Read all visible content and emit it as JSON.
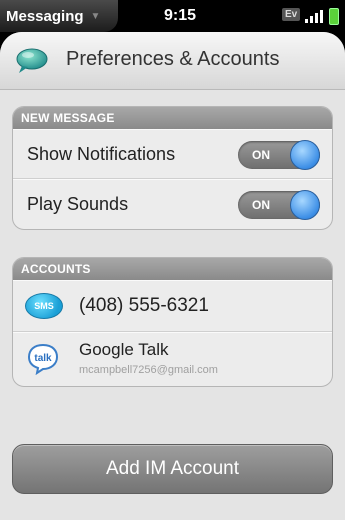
{
  "status_bar": {
    "app_name": "Messaging",
    "time": "9:15",
    "network": "Ev"
  },
  "header": {
    "title": "Preferences & Accounts",
    "icon": "messaging-bubble-icon"
  },
  "new_message": {
    "section_title": "NEW MESSAGE",
    "rows": [
      {
        "label": "Show Notifications",
        "toggle": "ON"
      },
      {
        "label": "Play Sounds",
        "toggle": "ON"
      }
    ]
  },
  "accounts": {
    "section_title": "ACCOUNTS",
    "items": [
      {
        "icon_text": "SMS",
        "name": "(408) 555-6321"
      },
      {
        "icon_text": "talk",
        "name": "Google Talk",
        "email": "mcampbell7256@gmail.com"
      }
    ]
  },
  "add_account_label": "Add IM Account",
  "colors": {
    "toggle_knob": "#3c8ee6",
    "battery": "#5bd23a",
    "section_header": "#9a9a9a"
  }
}
